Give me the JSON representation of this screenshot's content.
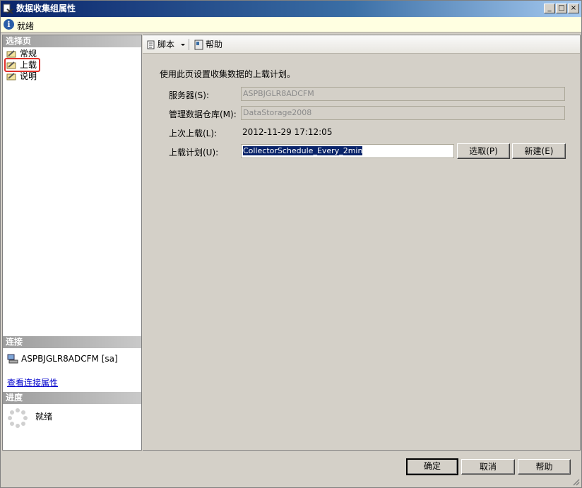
{
  "window": {
    "title": "数据收集组属性",
    "controls": {
      "minimize": "_",
      "maximize": "□",
      "close": "×"
    }
  },
  "status": {
    "text": "就绪",
    "icon": "info-icon"
  },
  "left": {
    "select_page_header": "选择页",
    "pages": [
      {
        "label": "常规",
        "icon": "wrench-page-icon"
      },
      {
        "label": "上载",
        "icon": "wrench-page-icon",
        "selected": true
      },
      {
        "label": "说明",
        "icon": "wrench-page-icon"
      }
    ],
    "connection_header": "连接",
    "connection": "ASPBJGLR8ADCFM [sa]",
    "view_connection_link": "查看连接属性",
    "progress_header": "进度",
    "progress_status": "就绪"
  },
  "toolbar": {
    "script_label": "脚本",
    "help_label": "帮助"
  },
  "main": {
    "description": "使用此页设置收集数据的上载计划。",
    "server_label": "服务器(S):",
    "server_value": "ASPBJGLR8ADCFM",
    "warehouse_label": "管理数据仓库(M):",
    "warehouse_value": "DataStorage2008",
    "last_upload_label": "上次上载(L):",
    "last_upload_value": "2012-11-29 17:12:05",
    "schedule_label": "上载计划(U):",
    "schedule_value": "CollectorSchedule_Every_2min",
    "pick_button": "选取(P)",
    "new_button": "新建(E)"
  },
  "footer": {
    "ok": "确定",
    "cancel": "取消",
    "help": "帮助"
  },
  "colors": {
    "title_bar": "#0a246a",
    "selection_outline": "#e0302a",
    "link": "#0000cc"
  }
}
